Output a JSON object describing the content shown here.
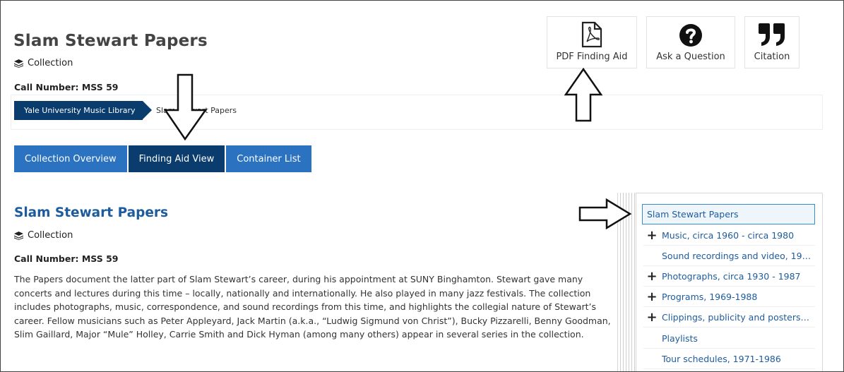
{
  "header": {
    "title": "Slam Stewart Papers",
    "type_label": "Collection",
    "type_icon": "layers-icon",
    "call_number": "Call Number: MSS 59"
  },
  "actions": [
    {
      "label": "PDF Finding Aid",
      "icon": "pdf-file-icon"
    },
    {
      "label": "Ask a Question",
      "icon": "question-circle-icon"
    },
    {
      "label": "Citation",
      "icon": "quote-icon"
    }
  ],
  "breadcrumb": {
    "first": "Yale University Music Library",
    "second": "Slam Stewart Papers"
  },
  "tabs": [
    {
      "label": "Collection Overview",
      "active": false
    },
    {
      "label": "Finding Aid View",
      "active": true
    },
    {
      "label": "Container List",
      "active": false
    }
  ],
  "main": {
    "title": "Slam Stewart Papers",
    "type_label": "Collection",
    "call_number": "Call Number: MSS 59",
    "description": "The Papers document the latter part of Slam Stewart’s career, during his appointment at SUNY Binghamton. Stewart gave many concerts and lectures during this time – locally, nationally and internationally. He also played in many jazz festivals. The collection includes photographs, music, correspondence, and sound recordings from this time, and highlights the collegial nature of Stewart’s career. Fellow musicians such as Peter Appleyard, Jack Martin (a.k.a., “Ludwig Sigmund von Christ”), Bucky Pizzarelli, Benny Goodman, Slim Gaillard, Major “Mule” Holley, Carrie Smith and Dick Hyman (among many others) appear in several series in the collection."
  },
  "tree": {
    "items": [
      {
        "label": "Slam Stewart Papers",
        "expandable": false,
        "selected": true
      },
      {
        "label": "Music, circa 1960 - circa 1980",
        "expandable": true,
        "selected": false
      },
      {
        "label": "Sound recordings and video, 19…",
        "expandable": false,
        "selected": false
      },
      {
        "label": "Photographs, circa 1930 - 1987",
        "expandable": true,
        "selected": false
      },
      {
        "label": "Programs, 1969-1988",
        "expandable": true,
        "selected": false
      },
      {
        "label": "Clippings, publicity and posters…",
        "expandable": true,
        "selected": false
      },
      {
        "label": "Playlists",
        "expandable": false,
        "selected": false
      },
      {
        "label": "Tour schedules, 1971-1986",
        "expandable": false,
        "selected": false
      }
    ]
  },
  "colors": {
    "accent_dark": "#0a3d6e",
    "accent": "#2b73c1",
    "link": "#1d5b9e"
  }
}
